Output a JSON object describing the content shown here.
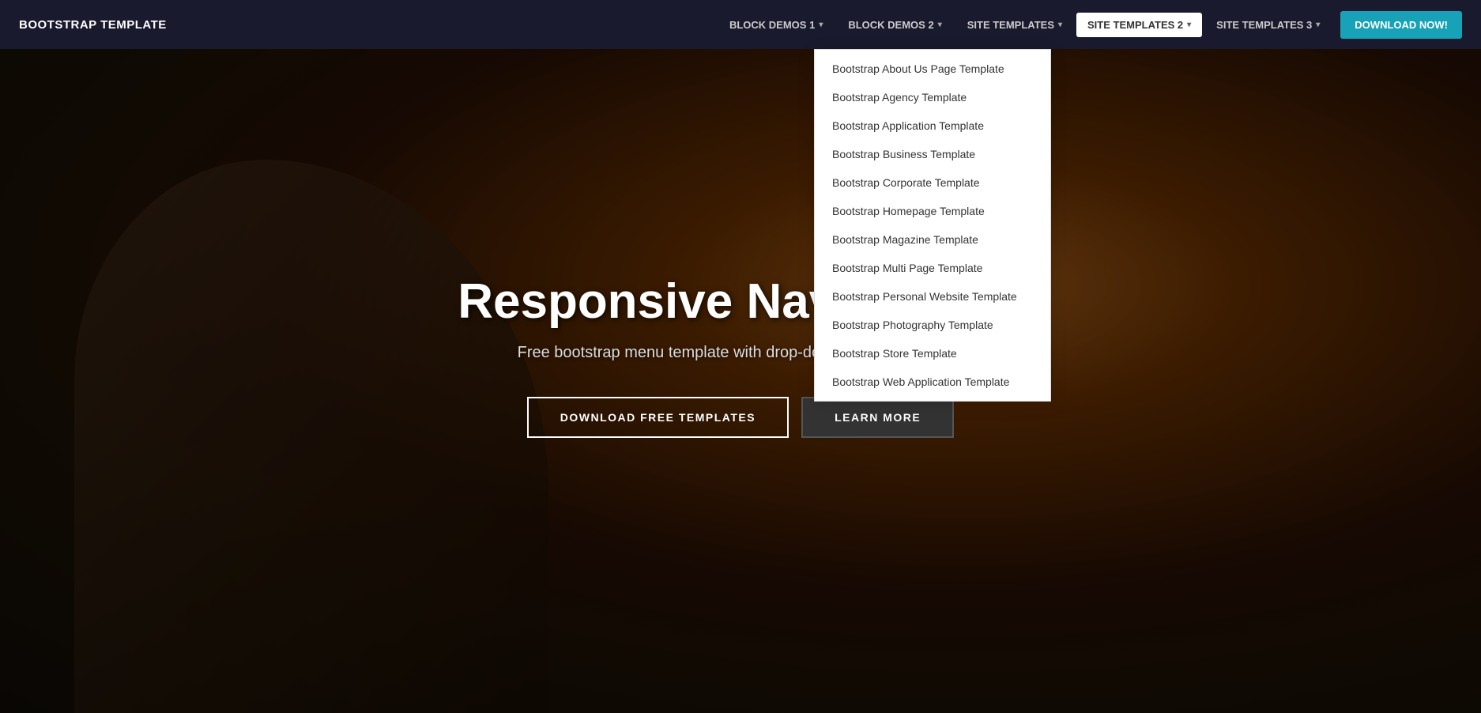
{
  "brand": "BOOTSTRAP TEMPLATE",
  "nav": {
    "items": [
      {
        "label": "BLOCK DEMOS 1",
        "id": "block-demos-1",
        "hasDropdown": true
      },
      {
        "label": "BLOCK DEMOS 2",
        "id": "block-demos-2",
        "hasDropdown": true
      },
      {
        "label": "SITE TEMPLATES",
        "id": "site-templates",
        "hasDropdown": true
      },
      {
        "label": "SITE TEMPLATES 2",
        "id": "site-templates-2",
        "hasDropdown": true,
        "active": true
      },
      {
        "label": "SITE TEMPLATES 3",
        "id": "site-templates-3",
        "hasDropdown": true
      }
    ],
    "downloadBtn": "DOWNLOAD NOW!"
  },
  "dropdown": {
    "items": [
      "Bootstrap About Us Page Template",
      "Bootstrap Agency Template",
      "Bootstrap Application Template",
      "Bootstrap Business Template",
      "Bootstrap Corporate Template",
      "Bootstrap Homepage Template",
      "Bootstrap Magazine Template",
      "Bootstrap Multi Page Template",
      "Bootstrap Personal Website Template",
      "Bootstrap Photography Template",
      "Bootstrap Store Template",
      "Bootstrap Web Application Template"
    ]
  },
  "hero": {
    "title": "Responsive Navbar Tem",
    "subtitle": "Free bootstrap menu template with drop-down lists and buttons.",
    "btn1": "DOWNLOAD FREE TEMPLATES",
    "btn2": "LEARN MORE"
  }
}
